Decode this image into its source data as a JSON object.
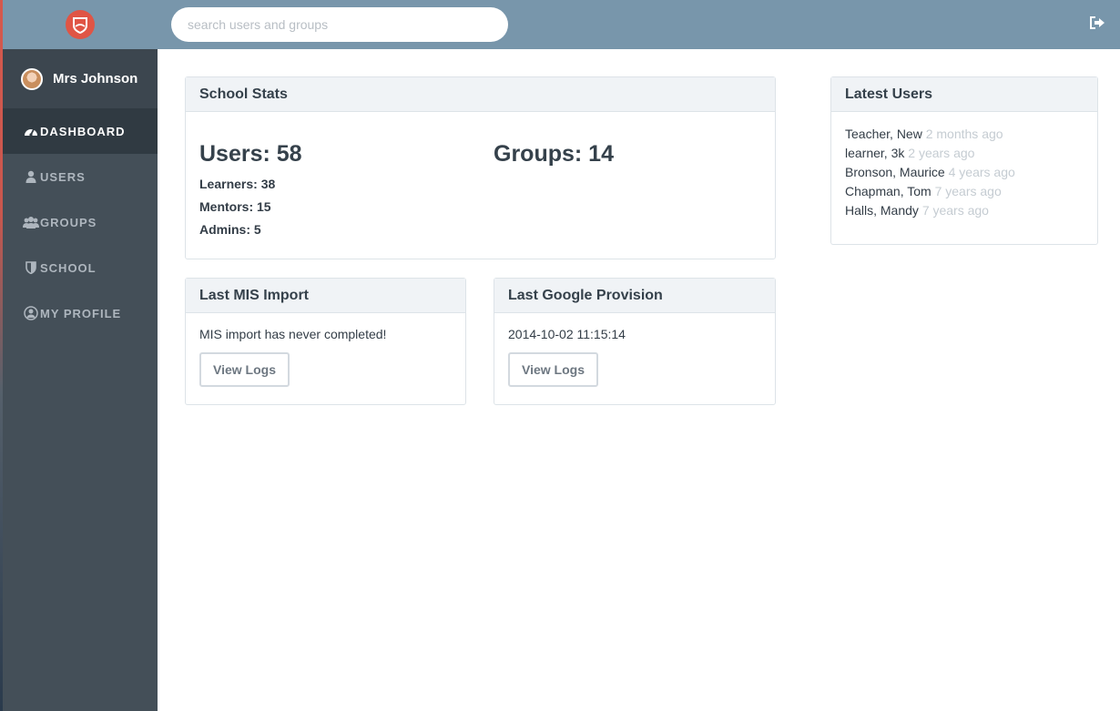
{
  "search": {
    "placeholder": "search users and groups"
  },
  "user": {
    "name": "Mrs Johnson"
  },
  "nav": [
    {
      "label": "DASHBOARD",
      "icon": "dashboard-icon",
      "active": true
    },
    {
      "label": "USERS",
      "icon": "user-icon",
      "active": false
    },
    {
      "label": "GROUPS",
      "icon": "groups-icon",
      "active": false
    },
    {
      "label": "SCHOOL",
      "icon": "shield-icon",
      "active": false
    },
    {
      "label": "MY PROFILE",
      "icon": "profile-icon",
      "active": false
    }
  ],
  "stats": {
    "title": "School Stats",
    "users_label": "Users: 58",
    "learners_label": "Learners:",
    "learners_value": "38",
    "mentors_label": "Mentors:",
    "mentors_value": "15",
    "admins_label": "Admins:",
    "admins_value": "5",
    "groups_label": "Groups: 14"
  },
  "mis": {
    "title": "Last MIS Import",
    "message": "MIS import has never completed!",
    "button": "View Logs"
  },
  "google": {
    "title": "Last Google Provision",
    "timestamp": "2014-10-02 11:15:14",
    "button": "View Logs"
  },
  "latest": {
    "title": "Latest Users",
    "items": [
      {
        "name": "Teacher, New",
        "time": "2 months ago"
      },
      {
        "name": "learner, 3k",
        "time": "2 years ago"
      },
      {
        "name": "Bronson, Maurice",
        "time": "4 years ago"
      },
      {
        "name": "Chapman, Tom",
        "time": "7 years ago"
      },
      {
        "name": "Halls, Mandy",
        "time": "7 years ago"
      }
    ]
  },
  "colors": {
    "topbar": "#7896ab",
    "sidebar": "#444f58",
    "sidebar_active": "#303a42",
    "brand_red": "#e05545"
  }
}
